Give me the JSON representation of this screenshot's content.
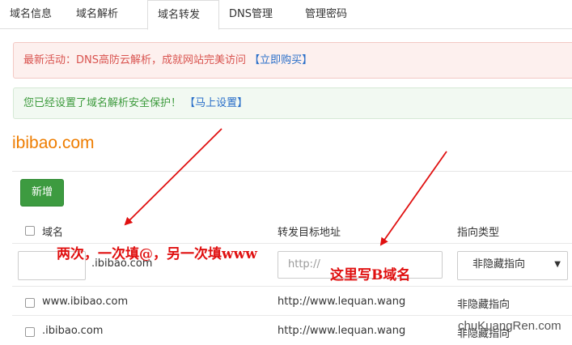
{
  "tabs": [
    {
      "label": "域名信息"
    },
    {
      "label": "域名解析"
    },
    {
      "label": "域名转发"
    },
    {
      "label": "DNS管理"
    },
    {
      "label": "管理密码"
    }
  ],
  "alerts": {
    "promo_text": "最新活动：DNS高防云解析，成就网站完美访问",
    "promo_link": "【立即购买】",
    "security_text": "您已经设置了域名解析安全保护！",
    "security_link": "【马上设置】"
  },
  "domain_title": "ibibao.com",
  "add_button": "新增",
  "table": {
    "headers": {
      "domain": "域名",
      "target": "转发目标地址",
      "type": "指向类型"
    },
    "new_row": {
      "domain_suffix": ".ibibao.com",
      "target_placeholder": "http://",
      "type_selected": "非隐藏指向"
    },
    "rows": [
      {
        "domain": "www.ibibao.com",
        "target": "http://www.lequan.wang",
        "type": "非隐藏指向"
      },
      {
        "domain": ".ibibao.com",
        "target": "http://www.lequan.wang",
        "type": "非隐藏指向"
      }
    ]
  },
  "annotations": {
    "left": "两次，一次填@，另一次填www",
    "right": "这里写B域名"
  },
  "watermark": "chuKuangRen.com",
  "colors": {
    "accent": "#ee7d00",
    "annotation": "#e01010",
    "add_button": "#3d9b40"
  }
}
